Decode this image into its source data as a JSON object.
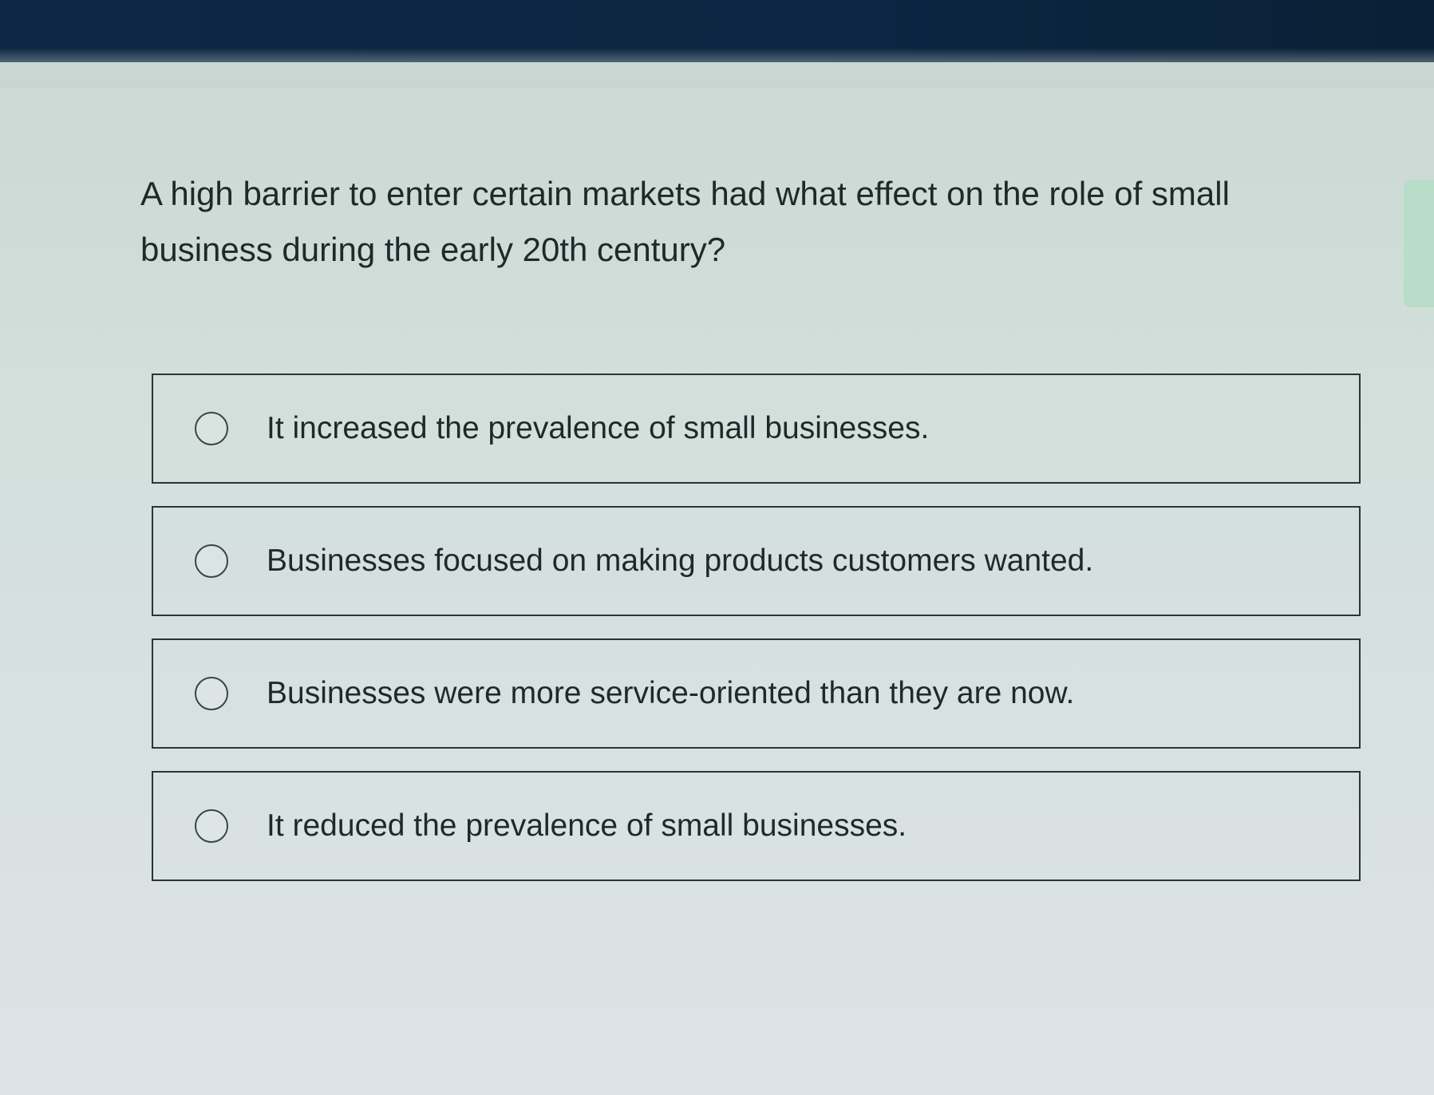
{
  "question": {
    "text": "A high barrier to enter certain markets had what effect on the role of small business during the early 20th century?"
  },
  "options": [
    {
      "label": "It increased the prevalence of small businesses.",
      "selected": false,
      "icon": "radio-unchecked-icon"
    },
    {
      "label": "Businesses focused on making products customers wanted.",
      "selected": false,
      "icon": "radio-unchecked-icon"
    },
    {
      "label": "Businesses were more service-oriented than they are now.",
      "selected": false,
      "icon": "radio-unchecked-icon"
    },
    {
      "label": "It reduced the prevalence of small businesses.",
      "selected": false,
      "icon": "radio-unchecked-icon"
    }
  ],
  "colors": {
    "header": "#0c2542",
    "page_background": "#d3e0dc",
    "side_tab": "#b8ddc9",
    "text": "#1e2a2a"
  }
}
